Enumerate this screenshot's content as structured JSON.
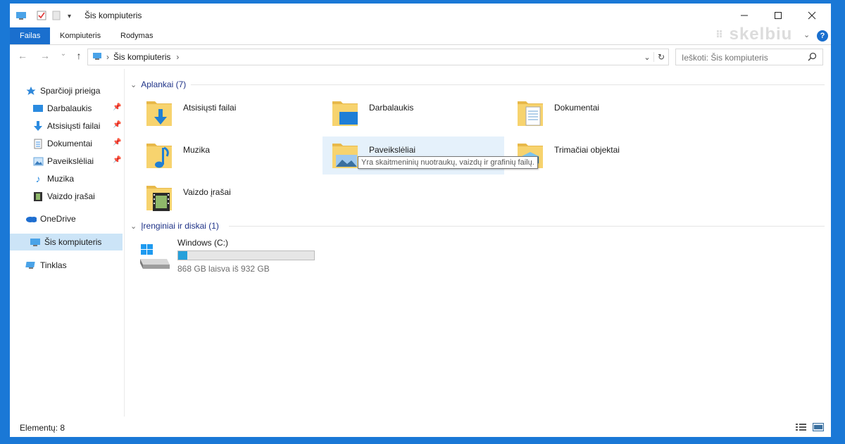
{
  "window": {
    "title": "Šis kompiuteris"
  },
  "ribbon": {
    "tabs": [
      "Failas",
      "Kompiuteris",
      "Rodymas"
    ]
  },
  "watermark": "skelbiu",
  "address": {
    "path": "Šis kompiuteris"
  },
  "search": {
    "placeholder": "Ieškoti: Šis kompiuteris"
  },
  "nav": {
    "quick_access": "Sparčioji prieiga",
    "items": [
      "Darbalaukis",
      "Atsisiųsti failai",
      "Dokumentai",
      "Paveikslėliai",
      "Muzika",
      "Vaizdo įrašai"
    ],
    "onedrive": "OneDrive",
    "this_pc": "Šis kompiuteris",
    "network": "Tinklas"
  },
  "folders": {
    "header": "Aplankai (7)",
    "items": [
      "Atsisiųsti failai",
      "Darbalaukis",
      "Dokumentai",
      "Muzika",
      "Paveikslėliai",
      "Trimačiai objektai",
      "Vaizdo įrašai"
    ],
    "tooltip": "Yra skaitmeninių nuotraukų, vaizdų ir grafinių failų."
  },
  "drives": {
    "header": "Įrenginiai ir diskai (1)",
    "name": "Windows (C:)",
    "space": "868 GB laisva iš 932 GB",
    "used_fraction": 0.069
  },
  "status": {
    "count": "Elementų: 8"
  },
  "colors": {
    "accent": "#1a6fce",
    "bar": "#26a0da",
    "desktop": "#1a78d6",
    "folder": "#f2c94c"
  }
}
